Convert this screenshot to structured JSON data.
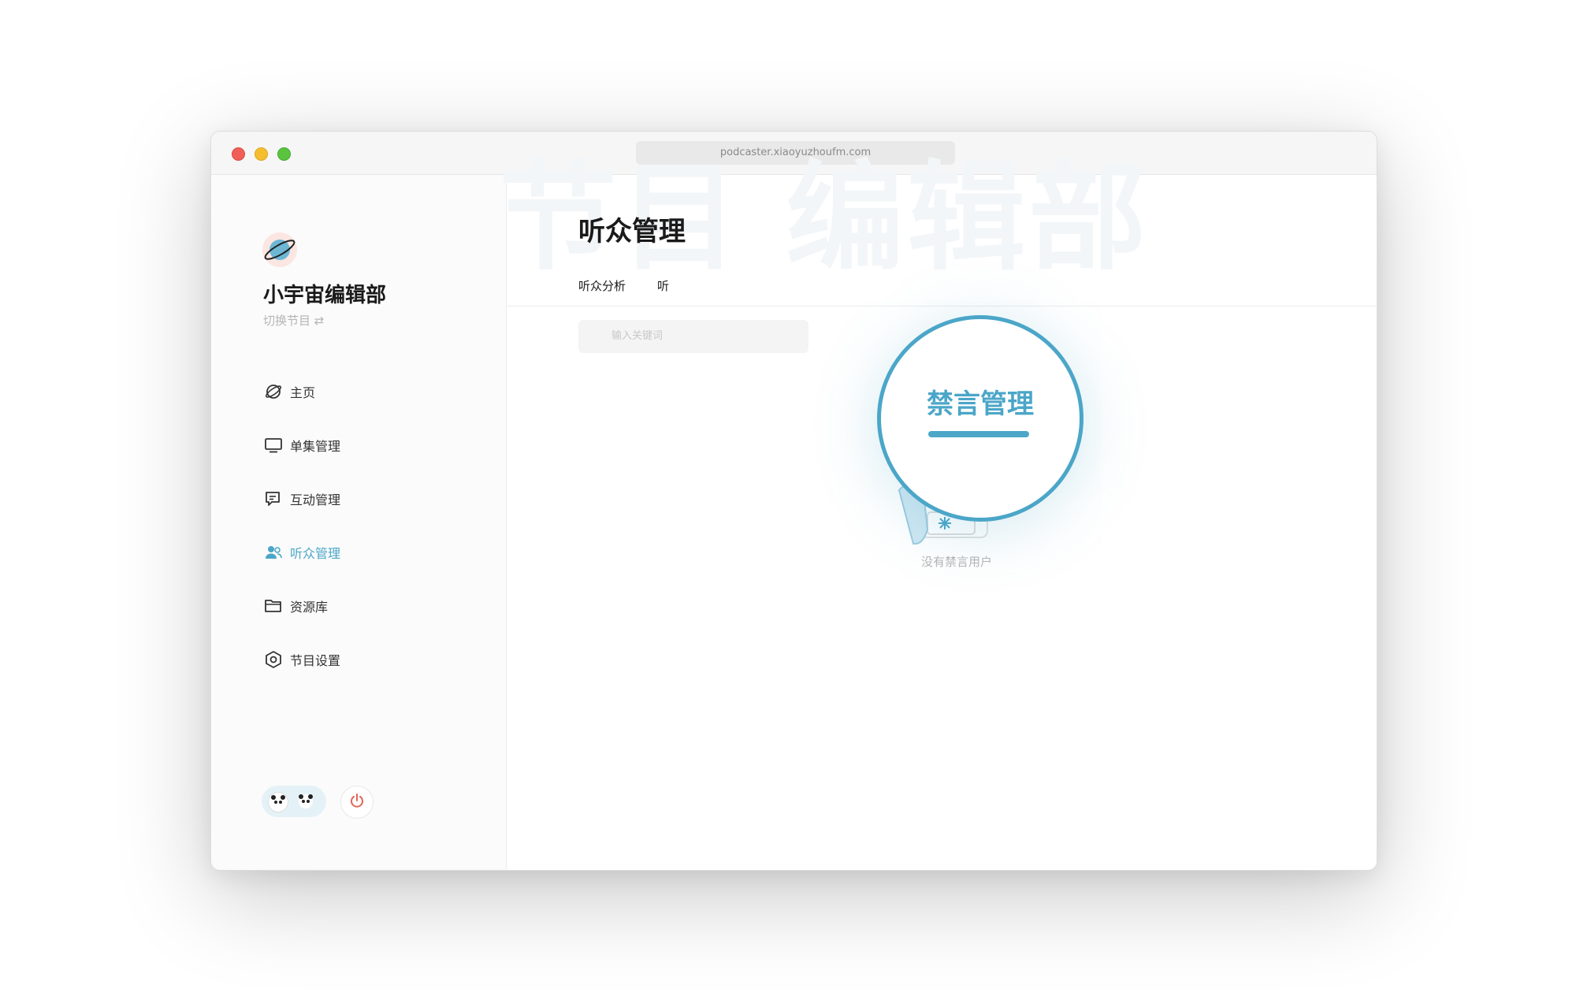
{
  "browser": {
    "url": "podcaster.xiaoyuzhoufm.com"
  },
  "sidebar": {
    "show_name": "小宇宙编辑部",
    "switch_label": "切换节目 ⇄",
    "items": [
      {
        "label": "主页",
        "icon": "planet-icon"
      },
      {
        "label": "单集管理",
        "icon": "monitor-icon"
      },
      {
        "label": "互动管理",
        "icon": "comment-icon"
      },
      {
        "label": "听众管理",
        "icon": "users-icon",
        "active": true
      },
      {
        "label": "资源库",
        "icon": "folder-icon"
      },
      {
        "label": "节目设置",
        "icon": "hexagon-settings-icon"
      }
    ],
    "accent_color": "#4ba6c8"
  },
  "main": {
    "title": "听众管理",
    "watermark": "节目  编辑部",
    "tabs": [
      "听众分析",
      "听"
    ],
    "search_placeholder": "输入关键词",
    "empty_text": "没有禁言用户"
  },
  "magnifier": {
    "label": "禁言管理"
  }
}
